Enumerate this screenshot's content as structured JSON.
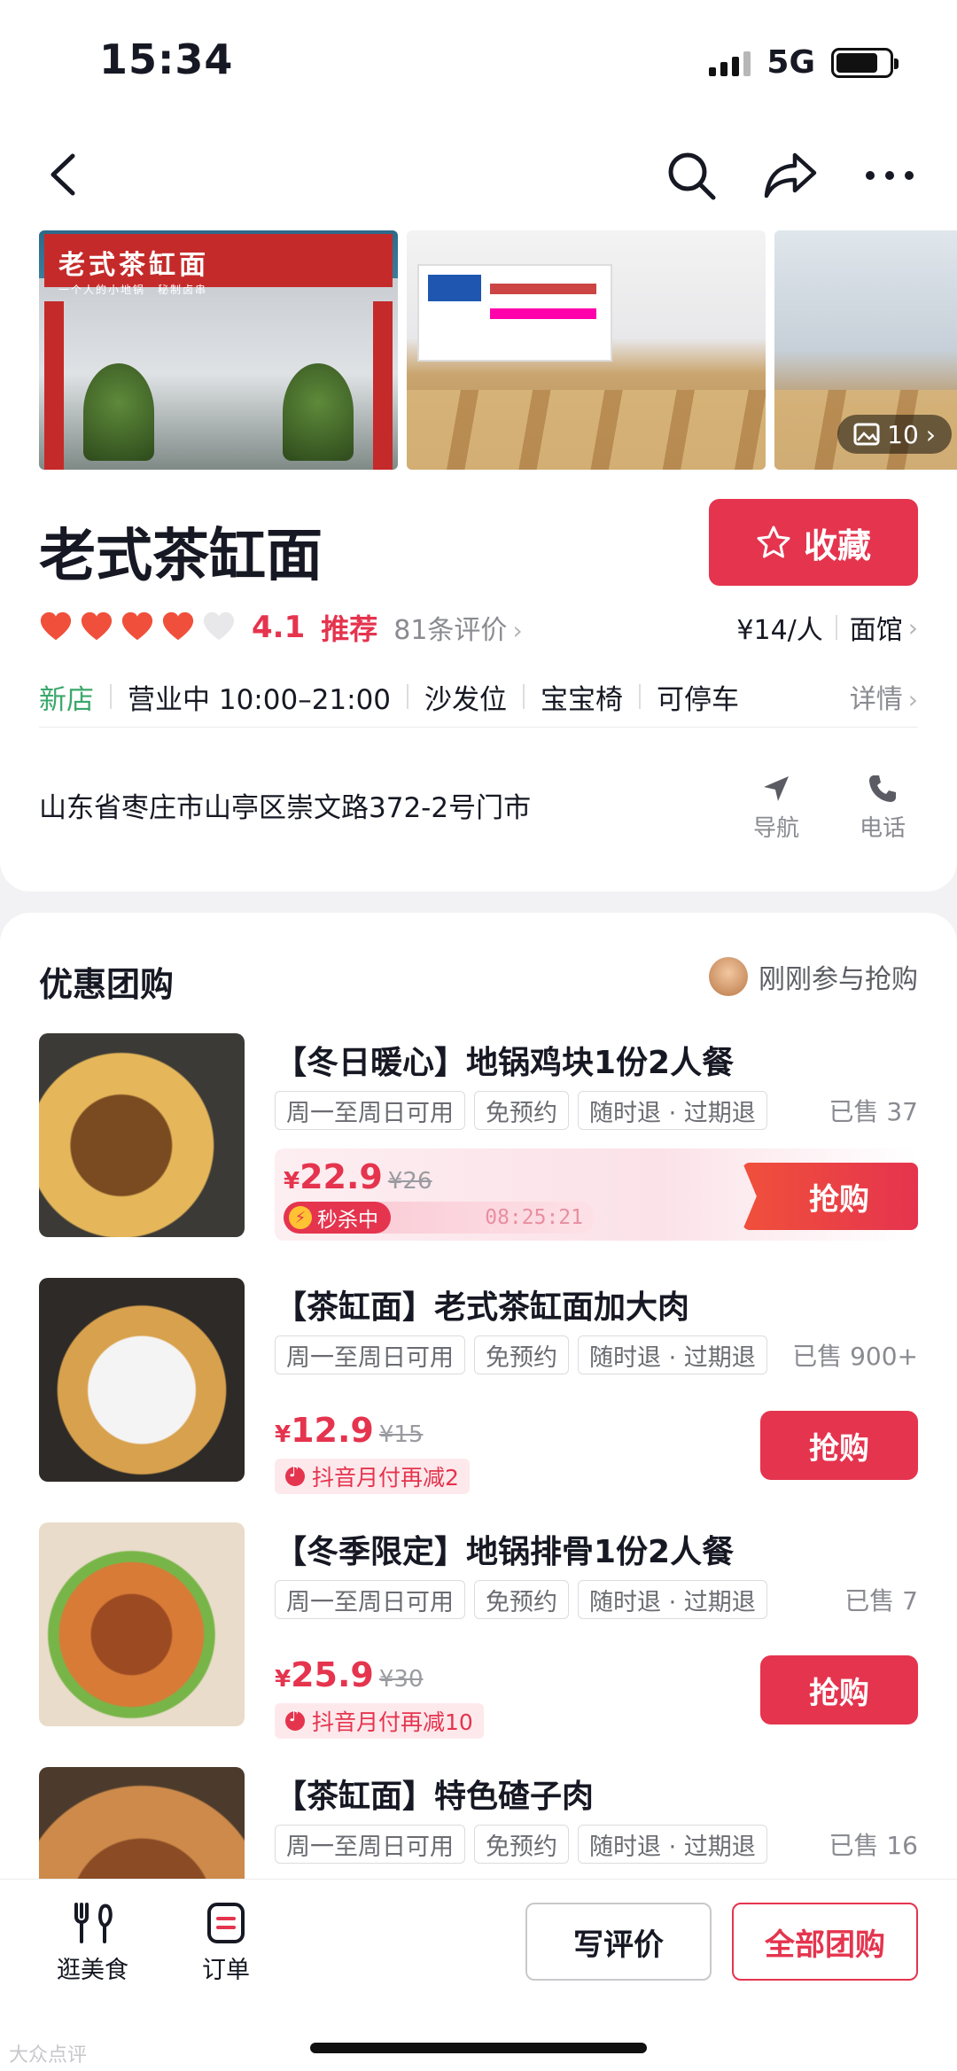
{
  "status": {
    "time": "15:34",
    "network": "5G"
  },
  "gallery": {
    "photo1_sign": "老式茶缸面",
    "photo1_sub": "一个人的小地锅　秘制卤串",
    "count": "10"
  },
  "shop": {
    "name": "老式茶缸面",
    "fav_label": "收藏",
    "score": "4.1",
    "recommend": "推荐",
    "reviews": "81条评价",
    "price_per": "¥14/人",
    "category": "面馆",
    "tag_new": "新店",
    "hours": "营业中 10:00–21:00",
    "facilities": [
      "沙发位",
      "宝宝椅",
      "可停车"
    ],
    "details": "详情",
    "address": "山东省枣庄市山亭区崇文路372-2号门市",
    "nav_label": "导航",
    "phone_label": "电话"
  },
  "deals": {
    "title": "优惠团购",
    "live_text": "刚刚参与抢购",
    "items": [
      {
        "title": "【冬日暖心】地锅鸡块1份2人餐",
        "tags": [
          "周一至周日可用",
          "免预约",
          "随时退 · 过期退"
        ],
        "sold": "已售 37",
        "price": "22.9",
        "orig": "¥26",
        "flash_label": "秒杀中",
        "countdown": "08:25:21",
        "buy": "抢购"
      },
      {
        "title": "【茶缸面】老式茶缸面加大肉",
        "tags": [
          "周一至周日可用",
          "免预约",
          "随时退 · 过期退"
        ],
        "sold": "已售 900+",
        "price": "12.9",
        "orig": "¥15",
        "promo": "抖音月付再减2",
        "buy": "抢购"
      },
      {
        "title": "【冬季限定】地锅排骨1份2人餐",
        "tags": [
          "周一至周日可用",
          "免预约",
          "随时退 · 过期退"
        ],
        "sold": "已售 7",
        "price": "25.9",
        "orig": "¥30",
        "promo": "抖音月付再减10",
        "buy": "抢购"
      },
      {
        "title": "【茶缸面】特色碴子肉",
        "tags": [
          "周一至周日可用",
          "免预约",
          "随时退 · 过期退"
        ],
        "sold": "已售 16"
      }
    ]
  },
  "bottom": {
    "tab_food": "逛美食",
    "tab_order": "订单",
    "write_review": "写评价",
    "all_deals": "全部团购",
    "watermark": "大众点评"
  },
  "colors": {
    "accent": "#e5344e",
    "new_tag": "#3aa86b"
  }
}
